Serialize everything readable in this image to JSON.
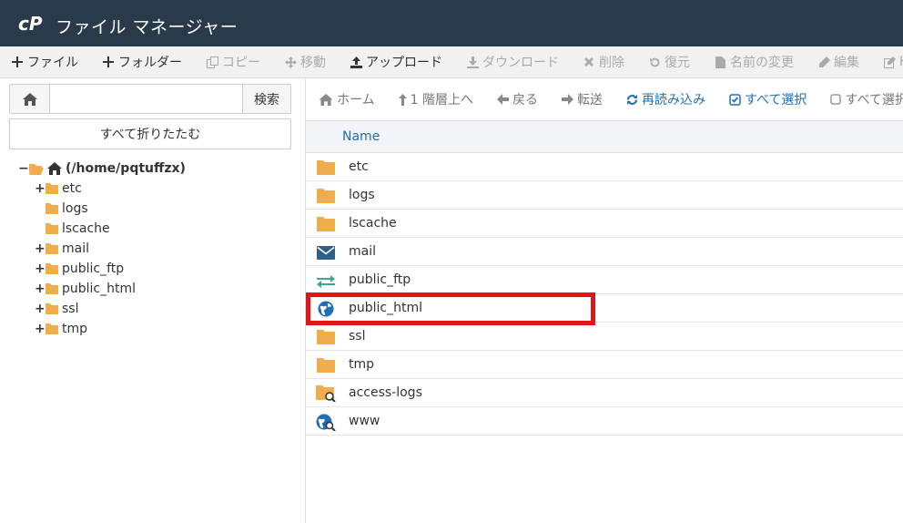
{
  "header": {
    "title": "ファイル マネージャー",
    "accent": "#293a4a"
  },
  "toolbar": {
    "items": [
      {
        "label": "ファイル",
        "icon": "plus-icon",
        "enabled": true
      },
      {
        "label": "フォルダー",
        "icon": "plus-icon",
        "enabled": true
      },
      {
        "label": "コピー",
        "icon": "copy-icon",
        "enabled": false
      },
      {
        "label": "移動",
        "icon": "move-icon",
        "enabled": false
      },
      {
        "label": "アップロード",
        "icon": "upload-icon",
        "enabled": true
      },
      {
        "label": "ダウンロード",
        "icon": "download-icon",
        "enabled": false
      },
      {
        "label": "削除",
        "icon": "delete-icon",
        "enabled": false
      },
      {
        "label": "復元",
        "icon": "restore-icon",
        "enabled": false
      },
      {
        "label": "名前の変更",
        "icon": "file-icon",
        "enabled": false
      },
      {
        "label": "編集",
        "icon": "pencil-icon",
        "enabled": false
      },
      {
        "label": "H",
        "icon": "edit-icon",
        "enabled": false
      }
    ]
  },
  "left": {
    "search_placeholder": "",
    "search_label": "検索",
    "collapse_label": "すべて折りたたむ",
    "root_label": "(/home/pqtuffzx)",
    "tree": [
      {
        "label": "etc",
        "expandable": true
      },
      {
        "label": "logs",
        "expandable": false
      },
      {
        "label": "lscache",
        "expandable": false
      },
      {
        "label": "mail",
        "expandable": true
      },
      {
        "label": "public_ftp",
        "expandable": true
      },
      {
        "label": "public_html",
        "expandable": true
      },
      {
        "label": "ssl",
        "expandable": true
      },
      {
        "label": "tmp",
        "expandable": true
      }
    ]
  },
  "nav": {
    "items": [
      {
        "label": "ホーム",
        "icon": "home-icon",
        "active": false
      },
      {
        "label": "1 階層上へ",
        "icon": "level-up-icon",
        "active": false
      },
      {
        "label": "戻る",
        "icon": "arrow-left-icon",
        "active": false
      },
      {
        "label": "転送",
        "icon": "arrow-right-icon",
        "active": false
      },
      {
        "label": "再読み込み",
        "icon": "refresh-icon",
        "active": true
      },
      {
        "label": "すべて選択",
        "icon": "checkbox-checked-icon",
        "active": true
      },
      {
        "label": "すべて選択",
        "icon": "checkbox-empty-icon",
        "active": false
      }
    ]
  },
  "table": {
    "header": "Name",
    "rows": [
      {
        "name": "etc",
        "icon": "folder-icon"
      },
      {
        "name": "logs",
        "icon": "folder-icon"
      },
      {
        "name": "lscache",
        "icon": "folder-icon"
      },
      {
        "name": "mail",
        "icon": "mail-icon"
      },
      {
        "name": "public_ftp",
        "icon": "transfer-icon"
      },
      {
        "name": "public_html",
        "icon": "globe-icon"
      },
      {
        "name": "ssl",
        "icon": "folder-icon"
      },
      {
        "name": "tmp",
        "icon": "folder-icon"
      },
      {
        "name": "access-logs",
        "icon": "folder-link-icon"
      },
      {
        "name": "www",
        "icon": "globe-link-icon"
      }
    ]
  },
  "colors": {
    "folder": "#f0ad4e",
    "link": "#1f6fb6",
    "highlight": "#e2141a",
    "mail": "#2c5f8a",
    "transfer": "#3aaa8c"
  }
}
